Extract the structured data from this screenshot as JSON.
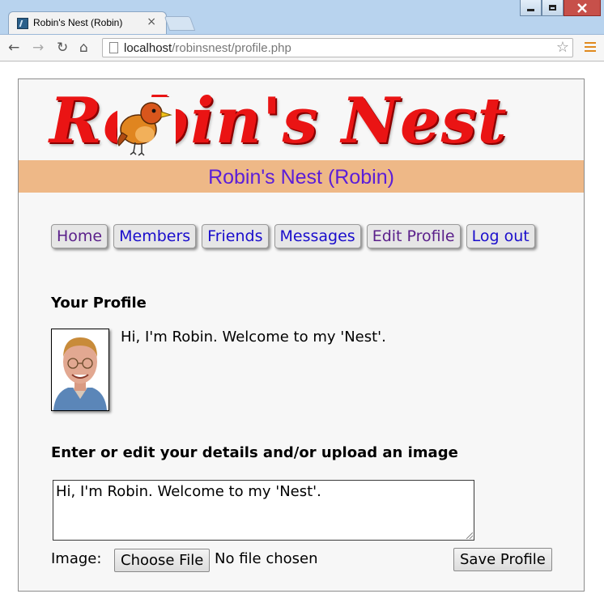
{
  "browser": {
    "tab_title": "Robin's Nest (Robin)",
    "tab_close": "×",
    "url_host": "localhost",
    "url_path": "/robinsnest/profile.php"
  },
  "site": {
    "logo_text": "Robin's Nest",
    "app_title": "Robin's Nest (Robin)"
  },
  "menu": [
    {
      "label": "Home",
      "visited": true
    },
    {
      "label": "Members",
      "visited": false
    },
    {
      "label": "Friends",
      "visited": false
    },
    {
      "label": "Messages",
      "visited": false
    },
    {
      "label": "Edit Profile",
      "visited": true
    },
    {
      "label": "Log out",
      "visited": false
    }
  ],
  "profile": {
    "heading": "Your Profile",
    "text": "Hi, I'm Robin. Welcome to my 'Nest'."
  },
  "edit": {
    "heading": "Enter or edit your details and/or upload an image",
    "textarea_value": "Hi, I'm Robin. Welcome to my 'Nest'.",
    "image_label": "Image:",
    "choose_file_label": "Choose File",
    "no_file_text": "No file chosen",
    "save_label": "Save Profile"
  },
  "colors": {
    "app_bar": "#eeb887",
    "app_title": "#5b1ed9",
    "logo": "#ea1414",
    "link": "#1a0dcc",
    "visited_link": "#5a1f8a"
  }
}
